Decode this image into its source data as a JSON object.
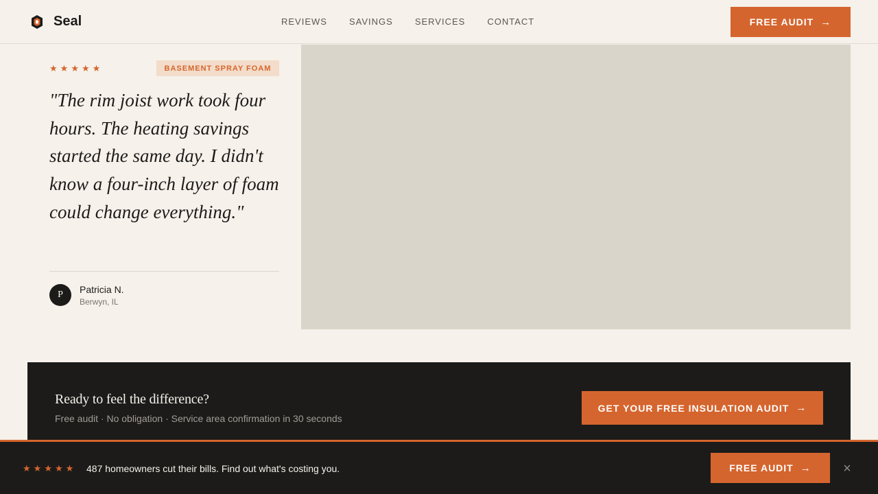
{
  "header": {
    "brand": "Seal",
    "nav": [
      "REVIEWS",
      "SAVINGS",
      "SERVICES",
      "CONTACT"
    ],
    "cta_label": "FREE AUDIT"
  },
  "testimonial": {
    "rating": 5,
    "tag": "BASEMENT SPRAY FOAM",
    "quote": "\"The rim joist work took four hours. The heating savings started the same day. I didn't know a four-inch layer of foam could change everything.\"",
    "author_initial": "P",
    "author_name": "Patricia N.",
    "author_location": "Berwyn, IL"
  },
  "cta": {
    "title": "Ready to feel the difference?",
    "subtitle": "Free audit · No obligation · Service area confirmation in 30 seconds",
    "button_label": "GET YOUR FREE INSULATION AUDIT"
  },
  "sticky_bar": {
    "rating": 5,
    "text": "487 homeowners cut their bills. Find out what's costing you.",
    "button_label": "FREE AUDIT"
  },
  "icons": {
    "arrow": "arrow-right-icon",
    "star": "star-icon",
    "close": "close-icon",
    "logo": "hexagon-shield-icon"
  },
  "colors": {
    "accent": "#d5652e",
    "background": "#f6f1ea",
    "dark": "#1c1b1a",
    "tag_bg": "#f3dcc9",
    "placeholder": "#d9d5ca"
  }
}
